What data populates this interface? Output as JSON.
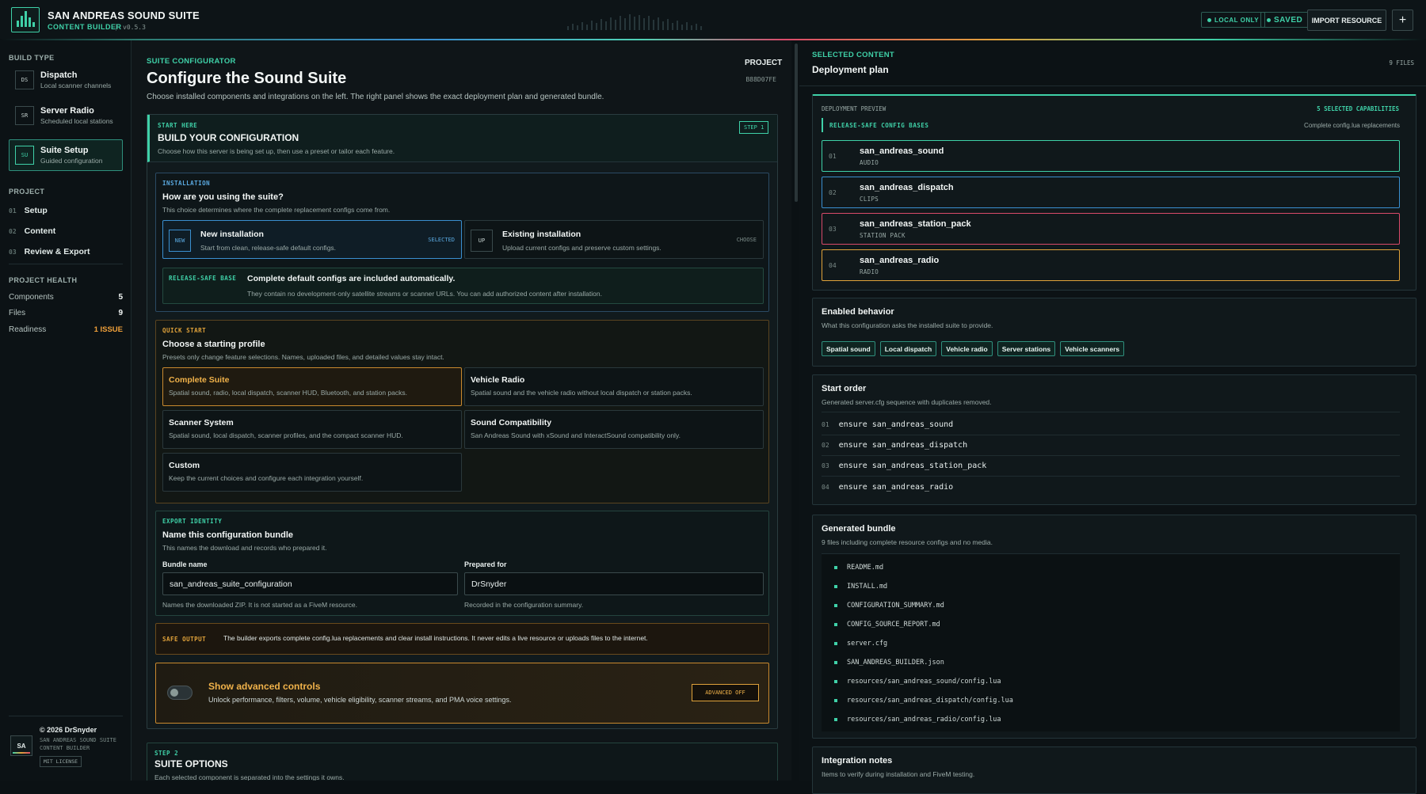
{
  "header": {
    "app_title": "SAN ANDREAS SOUND SUITE",
    "app_subtitle": "CONTENT BUILDER",
    "version": "v0.5.3",
    "local_only": "LOCAL ONLY",
    "saved": "SAVED",
    "import_button": "IMPORT RESOURCE",
    "add_button": "+"
  },
  "sidebar": {
    "build_type_heading": "BUILD TYPE",
    "build_types": [
      {
        "abbr": "DS",
        "title": "Dispatch",
        "desc": "Local scanner channels"
      },
      {
        "abbr": "SR",
        "title": "Server Radio",
        "desc": "Scheduled local stations"
      },
      {
        "abbr": "SU",
        "title": "Suite Setup",
        "desc": "Guided configuration"
      }
    ],
    "project_heading": "PROJECT",
    "nav": [
      {
        "num": "01",
        "label": "Setup"
      },
      {
        "num": "02",
        "label": "Content"
      },
      {
        "num": "03",
        "label": "Review & Export"
      }
    ],
    "health_heading": "PROJECT HEALTH",
    "health": [
      {
        "label": "Components",
        "value": "5"
      },
      {
        "label": "Files",
        "value": "9"
      },
      {
        "label": "Readiness",
        "value": "1 ISSUE"
      }
    ],
    "footer": {
      "logo": "SA",
      "copyright": "© 2026 DrSnyder",
      "line1": "SAN ANDREAS SOUND SUITE",
      "line2": "CONTENT BUILDER",
      "license": "MIT LICENSE"
    }
  },
  "main": {
    "kicker": "SUITE CONFIGURATOR",
    "title": "Configure the Sound Suite",
    "description": "Choose installed components and integrations on the left. The right panel shows the exact deployment plan and generated bundle.",
    "project_label": "PROJECT",
    "project_id": "B88D07FE",
    "start": {
      "tag": "START HERE",
      "title": "BUILD YOUR CONFIGURATION",
      "step": "STEP 1",
      "desc": "Choose how this server is being set up, then use a preset or tailor each feature."
    },
    "installation": {
      "tag": "INSTALLATION",
      "title": "How are you using the suite?",
      "desc": "This choice determines where the complete replacement configs come from.",
      "options": [
        {
          "abbr": "NEW",
          "title": "New installation",
          "desc": "Start from clean, release-safe default configs.",
          "status": "SELECTED"
        },
        {
          "abbr": "UP",
          "title": "Existing installation",
          "desc": "Upload current configs and preserve custom settings.",
          "status": "CHOOSE"
        }
      ],
      "notice_tag": "RELEASE-SAFE BASE",
      "notice_title": "Complete default configs are included automatically.",
      "notice_desc": "They contain no development-only satellite streams or scanner URLs. You can add authorized content after installation."
    },
    "quick_start": {
      "tag": "QUICK START",
      "title": "Choose a starting profile",
      "desc": "Presets only change feature selections. Names, uploaded files, and detailed values stay intact.",
      "profiles": [
        {
          "title": "Complete Suite",
          "desc": "Spatial sound, radio, local dispatch, scanner HUD, Bluetooth, and station packs."
        },
        {
          "title": "Vehicle Radio",
          "desc": "Spatial sound and the vehicle radio without local dispatch or station packs."
        },
        {
          "title": "Scanner System",
          "desc": "Spatial sound, local dispatch, scanner profiles, and the compact scanner HUD."
        },
        {
          "title": "Sound Compatibility",
          "desc": "San Andreas Sound with xSound and InteractSound compatibility only."
        },
        {
          "title": "Custom",
          "desc": "Keep the current choices and configure each integration yourself."
        }
      ]
    },
    "export": {
      "tag": "EXPORT IDENTITY",
      "title": "Name this configuration bundle",
      "desc": "This names the download and records who prepared it.",
      "bundle_label": "Bundle name",
      "bundle_value": "san_andreas_suite_configuration",
      "bundle_hint": "Names the downloaded ZIP. It is not started as a FiveM resource.",
      "prepared_label": "Prepared for",
      "prepared_value": "DrSnyder",
      "prepared_hint": "Recorded in the configuration summary."
    },
    "safe_output": {
      "tag": "SAFE OUTPUT",
      "text": "The builder exports complete config.lua replacements and clear install instructions. It never edits a live resource or uploads files to the internet."
    },
    "advanced": {
      "title": "Show advanced controls",
      "desc": "Unlock performance, filters, volume, vehicle eligibility, scanner streams, and PMA voice settings.",
      "button": "ADVANCED OFF"
    },
    "step2": {
      "tag": "STEP 2",
      "title": "SUITE OPTIONS",
      "desc": "Each selected component is separated into the settings it owns."
    }
  },
  "right": {
    "kicker": "SELECTED CONTENT",
    "title": "Deployment plan",
    "file_count": "9 FILES",
    "preview": {
      "label": "DEPLOYMENT PREVIEW",
      "capabilities": "5 SELECTED CAPABILITIES",
      "config_tag": "RELEASE-SAFE CONFIG BASES",
      "config_note": "Complete config.lua replacements",
      "items": [
        {
          "num": "01",
          "name": "san_andreas_sound",
          "tag": "AUDIO",
          "color": "#3fd1a8"
        },
        {
          "num": "02",
          "name": "san_andreas_dispatch",
          "tag": "CLIPS",
          "color": "#3a8fd0"
        },
        {
          "num": "03",
          "name": "san_andreas_station_pack",
          "tag": "STATION PACK",
          "color": "#d94a6a"
        },
        {
          "num": "04",
          "name": "san_andreas_radio",
          "tag": "RADIO",
          "color": "#e0a23a"
        }
      ]
    },
    "behavior": {
      "title": "Enabled behavior",
      "desc": "What this configuration asks the installed suite to provide.",
      "chips": [
        "Spatial sound",
        "Local dispatch",
        "Vehicle radio",
        "Server stations",
        "Vehicle scanners"
      ]
    },
    "start_order": {
      "title": "Start order",
      "desc": "Generated server.cfg sequence with duplicates removed.",
      "items": [
        {
          "num": "01",
          "cmd": "ensure san_andreas_sound"
        },
        {
          "num": "02",
          "cmd": "ensure san_andreas_dispatch"
        },
        {
          "num": "03",
          "cmd": "ensure san_andreas_station_pack"
        },
        {
          "num": "04",
          "cmd": "ensure san_andreas_radio"
        }
      ]
    },
    "bundle": {
      "title": "Generated bundle",
      "desc": "9 files including complete resource configs and no media.",
      "files": [
        "README.md",
        "INSTALL.md",
        "CONFIGURATION_SUMMARY.md",
        "CONFIG_SOURCE_REPORT.md",
        "server.cfg",
        "SAN_ANDREAS_BUILDER.json",
        "resources/san_andreas_sound/config.lua",
        "resources/san_andreas_dispatch/config.lua",
        "resources/san_andreas_radio/config.lua"
      ]
    },
    "notes": {
      "title": "Integration notes",
      "desc": "Items to verify during installation and FiveM testing."
    }
  }
}
